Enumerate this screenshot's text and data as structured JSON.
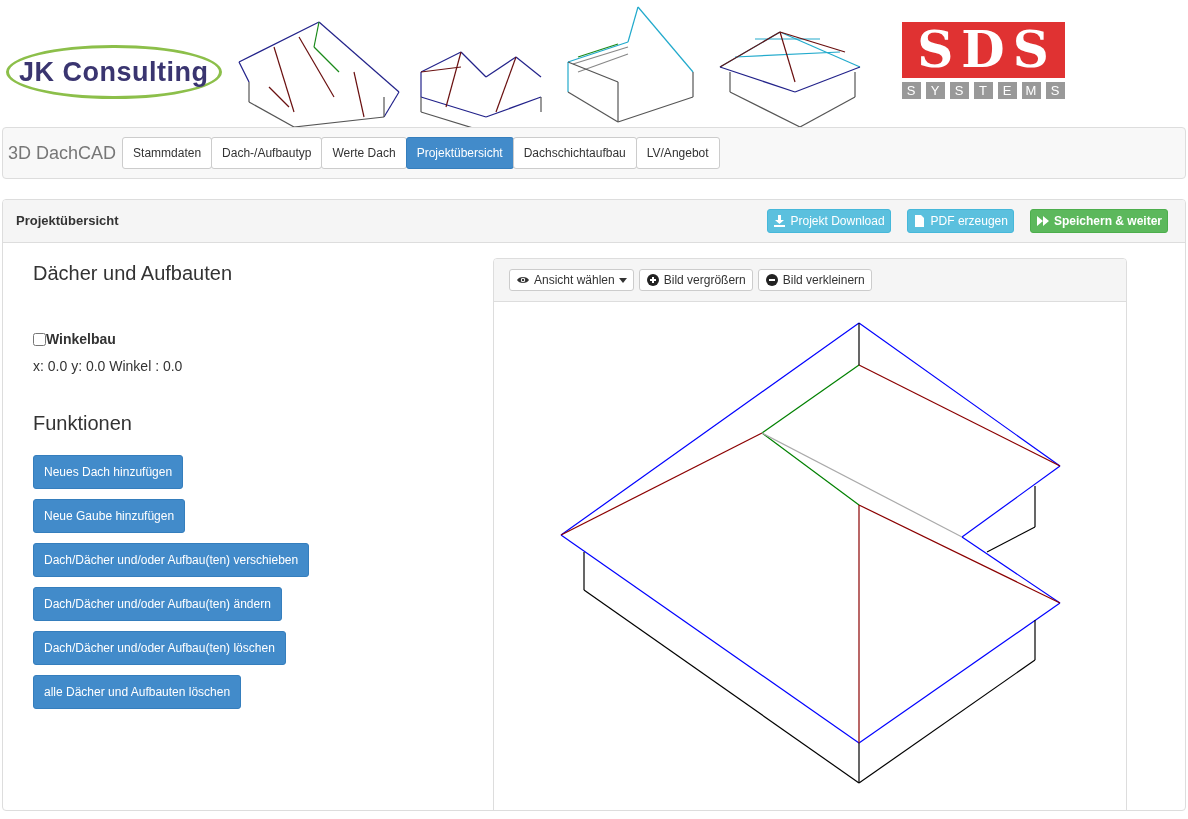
{
  "header": {
    "company_logo": "JK Consulting",
    "partner_logo": {
      "mark": "SDS",
      "letters": [
        "S",
        "Y",
        "S",
        "T",
        "E",
        "M",
        "S"
      ]
    }
  },
  "navbar": {
    "brand": "3D DachCAD",
    "tabs": [
      {
        "label": "Stammdaten",
        "selected": false
      },
      {
        "label": "Dach-/Aufbautyp",
        "selected": false
      },
      {
        "label": "Werte Dach",
        "selected": false
      },
      {
        "label": "Projektübersicht",
        "selected": true
      },
      {
        "label": "Dachschichtaufbau",
        "selected": false
      },
      {
        "label": "LV/Angebot",
        "selected": false
      }
    ]
  },
  "panel": {
    "title": "Projektübersicht",
    "actions": [
      {
        "label": "Projekt Download",
        "kind": "download"
      },
      {
        "label": "PDF erzeugen",
        "kind": "pdf"
      },
      {
        "label": "Speichern & weiter",
        "kind": "next"
      }
    ]
  },
  "roofs": {
    "heading": "Dächer und Aufbauten",
    "winkelbau": {
      "label": "Winkelbau",
      "checked": false
    },
    "coords": "x: 0.0 y: 0.0 Winkel : 0.0"
  },
  "functions": {
    "heading": "Funktionen",
    "buttons": [
      "Neues Dach hinzufügen",
      "Neue Gaube hinzufügen",
      "Dach/Dächer und/oder Aufbau(ten) verschieben",
      "Dach/Dächer und/oder Aufbau(ten) ändern",
      "Dach/Dächer und/oder Aufbau(ten) löschen",
      "alle Dächer und Aufbauten löschen"
    ]
  },
  "viewer": {
    "tools": [
      {
        "label": "Ansicht wählen",
        "kind": "view"
      },
      {
        "label": "Bild vergrößern",
        "kind": "zoom-in"
      },
      {
        "label": "Bild verkleinern",
        "kind": "zoom-out"
      }
    ]
  }
}
